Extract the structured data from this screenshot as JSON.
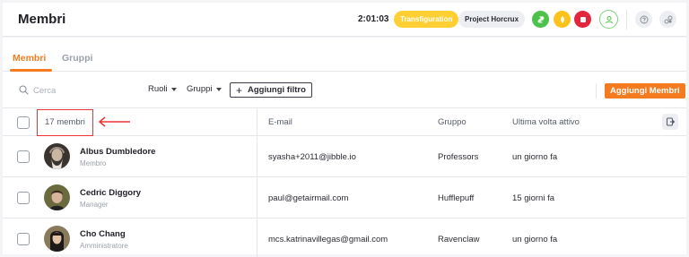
{
  "header": {
    "title": "Membri",
    "timer": "2:01:03",
    "activity": "Transfiguration",
    "project": "Project Horcrux"
  },
  "tabs": [
    {
      "label": "Membri",
      "active": true
    },
    {
      "label": "Gruppi",
      "active": false
    }
  ],
  "filters": {
    "search_placeholder": "Cerca",
    "roles_label": "Ruoli",
    "groups_label": "Gruppi",
    "add_filter_label": "Aggiungi filtro",
    "add_members_label": "Aggiungi Membri"
  },
  "table": {
    "count_label": "17 membri",
    "columns": [
      "E-mail",
      "Gruppo",
      "Ultima volta attivo"
    ],
    "rows": [
      {
        "name": "Albus Dumbledore",
        "role": "Membro",
        "email": "syasha+2011@jibble.io",
        "group": "Professors",
        "last_active": "un giorno fa"
      },
      {
        "name": "Cedric Diggory",
        "role": "Manager",
        "email": "paul@getairmail.com",
        "group": "Hufflepuff",
        "last_active": "15 giorni fa"
      },
      {
        "name": "Cho Chang",
        "role": "Amministratore",
        "email": "mcs.katrinavillegas@gmail.com",
        "group": "Ravenclaw",
        "last_active": "un giorno fa"
      }
    ]
  },
  "colors": {
    "accent": "#f47b20",
    "activity_badge": "#ffcf33",
    "switch_green": "#4cc24a",
    "break_yellow": "#ffc21a",
    "stop_red": "#e3263d",
    "annotation_red": "#e33"
  },
  "icons": [
    "switch-icon",
    "coffee-icon",
    "stop-icon",
    "user-icon",
    "help-icon",
    "apps-icon",
    "search-icon",
    "export-icon",
    "red-arrow-annotation"
  ]
}
